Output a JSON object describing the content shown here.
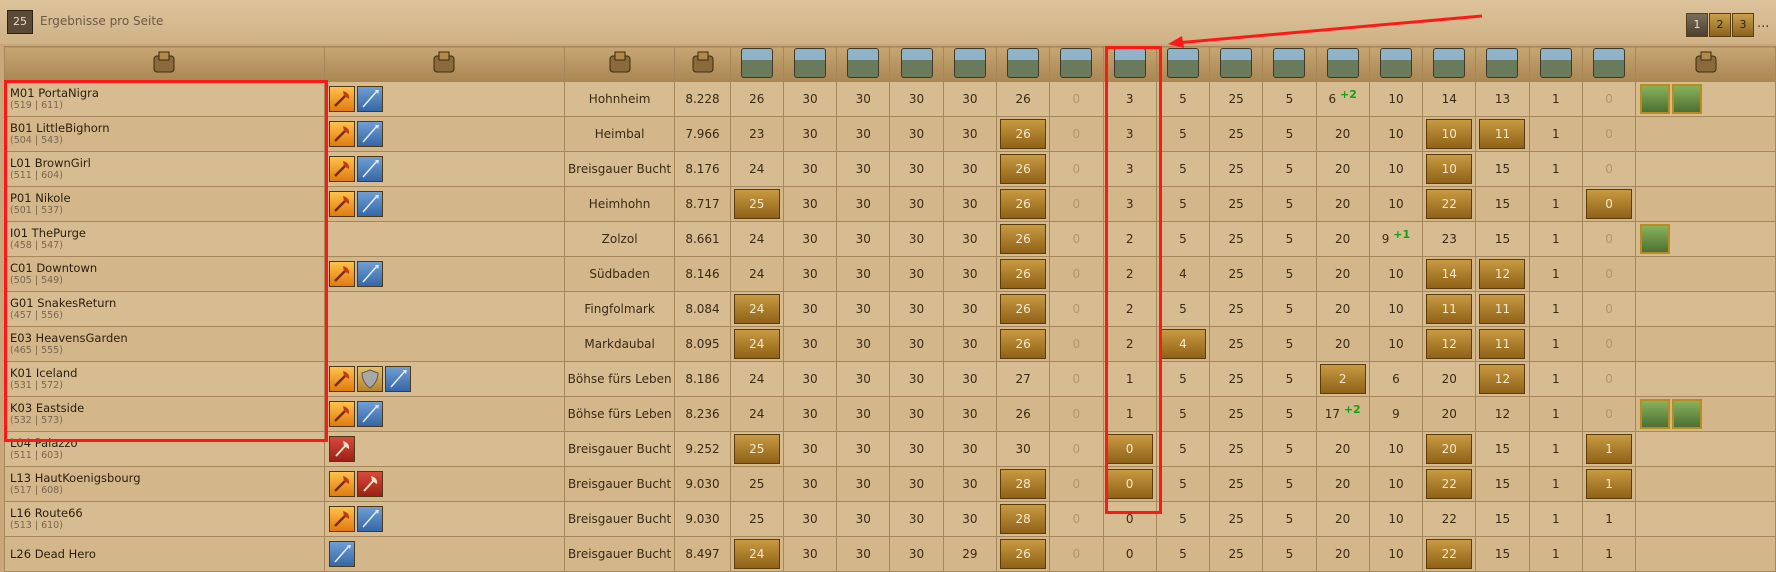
{
  "topbar": {
    "per_page_value": "25",
    "per_page_label": "Ergebnisse pro Seite",
    "pages": [
      "1",
      "2",
      "3"
    ],
    "current_page": "1",
    "more": "..."
  },
  "header_icons": [
    "castle-icon",
    "flags-icon",
    "region-icon",
    "points-icon",
    "building-icon",
    "building-icon",
    "building-icon",
    "building-icon",
    "building-icon",
    "building-icon",
    "building-icon",
    "building-icon",
    "building-icon",
    "building-icon",
    "building-icon",
    "building-icon",
    "building-icon",
    "building-icon",
    "building-icon",
    "building-icon",
    "building-icon",
    "tools-icon"
  ],
  "rows": [
    {
      "name": "M01 PortaNigra",
      "coords": "(519 | 611)",
      "flags": [
        "axe",
        "spear"
      ],
      "region": "Hohnheim",
      "points": "8.228",
      "values": [
        "26",
        "30",
        "30",
        "30",
        "30",
        "26",
        "0",
        "3",
        "5",
        "25",
        "5",
        "6",
        "10",
        "14",
        "13",
        "1",
        "0"
      ],
      "gold": [],
      "bonus": {
        "11": "+2"
      },
      "trade": 2
    },
    {
      "name": "B01 LittleBighorn",
      "coords": "(504 | 543)",
      "flags": [
        "axe",
        "spear"
      ],
      "region": "Heimbal",
      "points": "7.966",
      "values": [
        "23",
        "30",
        "30",
        "30",
        "30",
        "26",
        "0",
        "3",
        "5",
        "25",
        "5",
        "20",
        "10",
        "10",
        "11",
        "1",
        "0"
      ],
      "gold": [
        5,
        13,
        14
      ],
      "bonus": {},
      "trade": 0
    },
    {
      "name": "L01 BrownGirl",
      "coords": "(511 | 604)",
      "flags": [
        "axe",
        "spear"
      ],
      "region": "Breisgauer Bucht",
      "points": "8.176",
      "values": [
        "24",
        "30",
        "30",
        "30",
        "30",
        "26",
        "0",
        "3",
        "5",
        "25",
        "5",
        "20",
        "10",
        "10",
        "15",
        "1",
        "0"
      ],
      "gold": [
        5,
        13
      ],
      "bonus": {},
      "trade": 0
    },
    {
      "name": "P01 Nikole",
      "coords": "(501 | 537)",
      "flags": [
        "axe",
        "spear"
      ],
      "region": "Heimhohn",
      "points": "8.717",
      "values": [
        "25",
        "30",
        "30",
        "30",
        "30",
        "26",
        "0",
        "3",
        "5",
        "25",
        "5",
        "20",
        "10",
        "22",
        "15",
        "1",
        "0"
      ],
      "gold": [
        0,
        5,
        13,
        16
      ],
      "bonus": {},
      "trade": 0
    },
    {
      "name": "I01 ThePurge",
      "coords": "(458 | 547)",
      "flags": [],
      "region": "Zolzol",
      "points": "8.661",
      "values": [
        "24",
        "30",
        "30",
        "30",
        "30",
        "26",
        "0",
        "2",
        "5",
        "25",
        "5",
        "20",
        "9",
        "23",
        "15",
        "1",
        "0"
      ],
      "gold": [
        5
      ],
      "bonus": {
        "12": "+1"
      },
      "trade": 1
    },
    {
      "name": "C01 Downtown",
      "coords": "(505 | 549)",
      "flags": [
        "axe",
        "spear"
      ],
      "region": "Südbaden",
      "points": "8.146",
      "values": [
        "24",
        "30",
        "30",
        "30",
        "30",
        "26",
        "0",
        "2",
        "4",
        "25",
        "5",
        "20",
        "10",
        "14",
        "12",
        "1",
        "0"
      ],
      "gold": [
        5,
        13,
        14
      ],
      "bonus": {},
      "trade": 0
    },
    {
      "name": "G01 SnakesReturn",
      "coords": "(457 | 556)",
      "flags": [],
      "region": "Fingfolmark",
      "points": "8.084",
      "values": [
        "24",
        "30",
        "30",
        "30",
        "30",
        "26",
        "0",
        "2",
        "5",
        "25",
        "5",
        "20",
        "10",
        "11",
        "11",
        "1",
        "0"
      ],
      "gold": [
        0,
        5,
        13,
        14
      ],
      "bonus": {},
      "trade": 0
    },
    {
      "name": "E03 HeavensGarden",
      "coords": "(465 | 555)",
      "flags": [],
      "region": "Markdaubal",
      "points": "8.095",
      "values": [
        "24",
        "30",
        "30",
        "30",
        "30",
        "26",
        "0",
        "2",
        "4",
        "25",
        "5",
        "20",
        "10",
        "12",
        "11",
        "1",
        "0"
      ],
      "gold": [
        0,
        5,
        8,
        13,
        14
      ],
      "bonus": {},
      "trade": 0
    },
    {
      "name": "K01 Iceland",
      "coords": "(531 | 572)",
      "flags": [
        "axe",
        "shield",
        "spear"
      ],
      "region": "Böhse fürs Leben",
      "points": "8.186",
      "values": [
        "24",
        "30",
        "30",
        "30",
        "30",
        "27",
        "0",
        "1",
        "5",
        "25",
        "5",
        "2",
        "6",
        "20",
        "12",
        "1",
        "0"
      ],
      "gold": [
        11,
        14
      ],
      "bonus": {},
      "trade": 0
    },
    {
      "name": "K03 Eastside",
      "coords": "(532 | 573)",
      "flags": [
        "axe",
        "spear"
      ],
      "region": "Böhse fürs Leben",
      "points": "8.236",
      "values": [
        "24",
        "30",
        "30",
        "30",
        "30",
        "26",
        "0",
        "1",
        "5",
        "25",
        "5",
        "17",
        "9",
        "20",
        "12",
        "1",
        "0"
      ],
      "gold": [],
      "bonus": {
        "11": "+2"
      },
      "trade": 2
    },
    {
      "name": "L04 Palazzo",
      "coords": "(511 | 603)",
      "flags": [
        "redaxe"
      ],
      "region": "Breisgauer Bucht",
      "points": "9.252",
      "values": [
        "25",
        "30",
        "30",
        "30",
        "30",
        "30",
        "0",
        "0",
        "5",
        "25",
        "5",
        "20",
        "10",
        "20",
        "15",
        "1",
        "1"
      ],
      "gold": [
        0,
        7,
        13,
        16
      ],
      "bonus": {},
      "trade": 0
    },
    {
      "name": "L13 HautKoenigsbourg",
      "coords": "(517 | 608)",
      "flags": [
        "axe",
        "redaxe"
      ],
      "region": "Breisgauer Bucht",
      "points": "9.030",
      "values": [
        "25",
        "30",
        "30",
        "30",
        "30",
        "28",
        "0",
        "0",
        "5",
        "25",
        "5",
        "20",
        "10",
        "22",
        "15",
        "1",
        "1"
      ],
      "gold": [
        5,
        7,
        13,
        16
      ],
      "bonus": {},
      "trade": 0
    },
    {
      "name": "L16 Route66",
      "coords": "(513 | 610)",
      "flags": [
        "axe",
        "spear"
      ],
      "region": "Breisgauer Bucht",
      "points": "9.030",
      "values": [
        "25",
        "30",
        "30",
        "30",
        "30",
        "28",
        "0",
        "0",
        "5",
        "25",
        "5",
        "20",
        "10",
        "22",
        "15",
        "1",
        "1"
      ],
      "gold": [
        5
      ],
      "bonus": {},
      "trade": 0
    },
    {
      "name": "L26 Dead Hero",
      "coords": "",
      "flags": [
        "spear"
      ],
      "region": "Breisgauer Bucht",
      "points": "8.497",
      "values": [
        "24",
        "30",
        "30",
        "30",
        "29",
        "26",
        "0",
        "0",
        "5",
        "25",
        "5",
        "20",
        "10",
        "22",
        "15",
        "1",
        "1"
      ],
      "gold": [
        0,
        5,
        13
      ],
      "bonus": {},
      "trade": 0
    }
  ],
  "colors": {
    "highlight": "#ff1818",
    "gold_cell": "#b0822e",
    "row_bg": "#d8bc91"
  }
}
